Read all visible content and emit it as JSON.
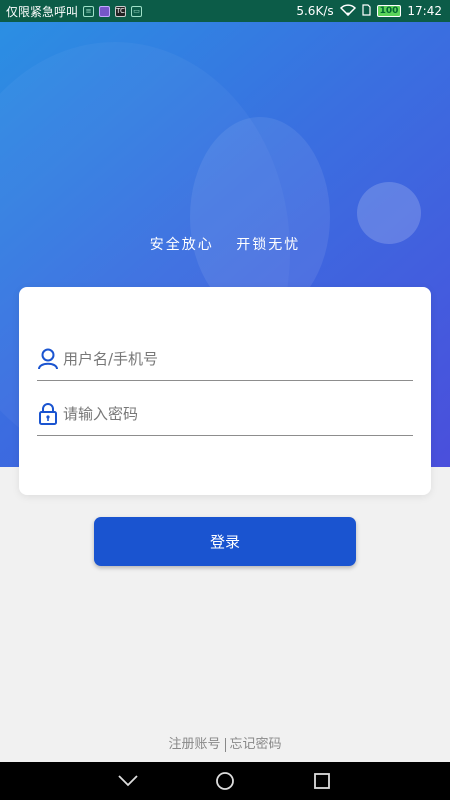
{
  "status_bar": {
    "carrier": "仅限紧急呼叫",
    "speed": "5.6K/s",
    "battery": "100",
    "time": "17:42"
  },
  "hero": {
    "slogan_part1": "安全放心",
    "slogan_part2": "开锁无忧"
  },
  "form": {
    "username_placeholder": "用户名/手机号",
    "password_placeholder": "请输入密码"
  },
  "login_button": "登录",
  "links": {
    "register": "注册账号",
    "forgot": "忘记密码"
  },
  "colors": {
    "primary": "#1a54d0",
    "status_bar_bg": "#0c5c48",
    "page_bg": "#f1f1f1"
  }
}
